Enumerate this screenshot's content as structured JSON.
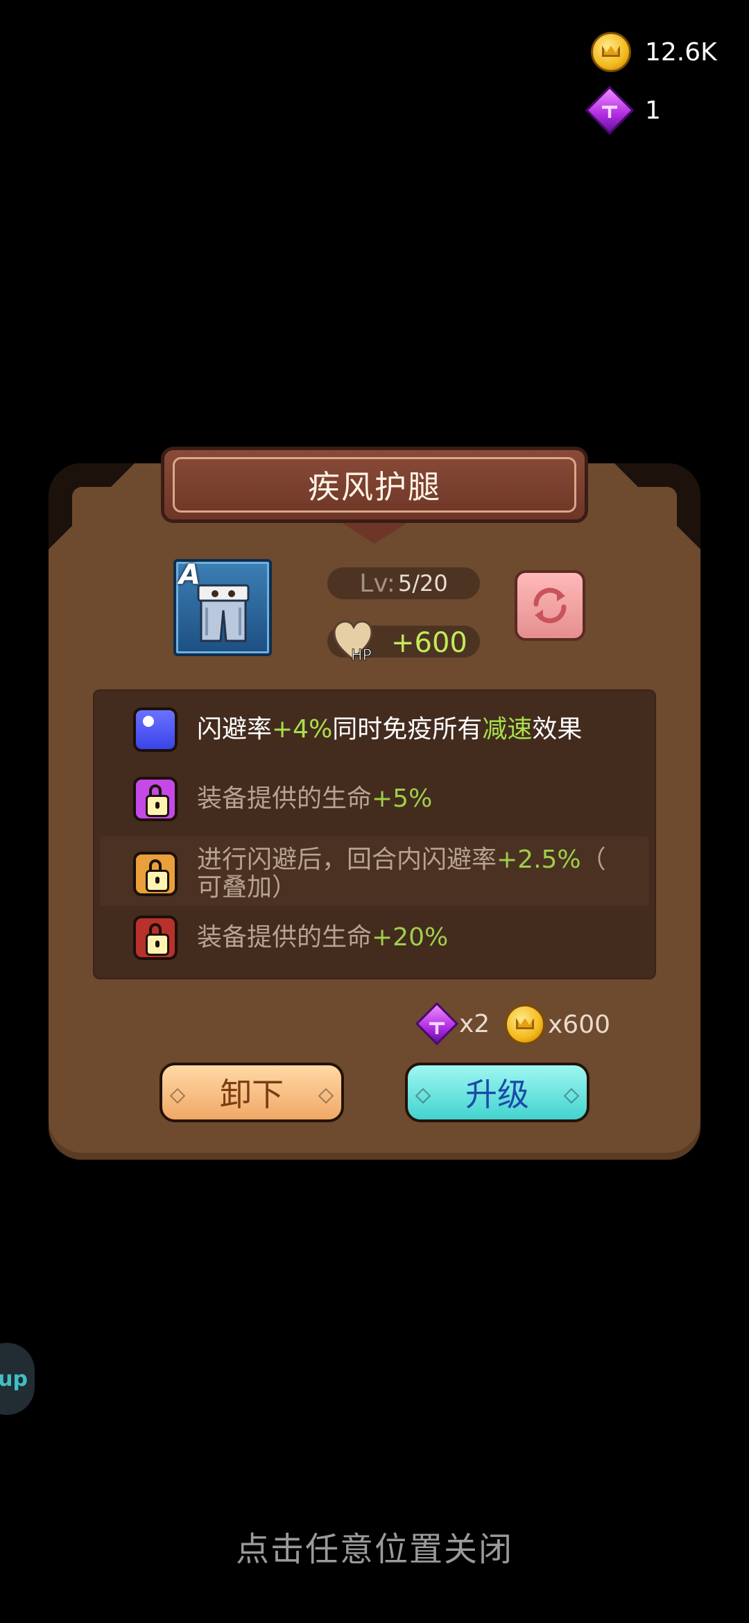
{
  "currency": {
    "coins": "12.6K",
    "gems": "1"
  },
  "item": {
    "name": "疾风护腿",
    "grade": "A",
    "level_label": "Lv:",
    "level_value": "5/20",
    "stat_label": "HP",
    "stat_value": "+600"
  },
  "effects": [
    {
      "state": "active",
      "icon": "blue-dot-icon",
      "parts": [
        "闪避率",
        "+4%",
        "同时免疫所有",
        "减速",
        "效果"
      ]
    },
    {
      "state": "locked",
      "icon": "purple-lock-icon",
      "parts": [
        "装备提供的生命",
        "+5%"
      ]
    },
    {
      "state": "locked",
      "icon": "orange-lock-icon",
      "parts": [
        "进行闪避后，回合内闪避率",
        "+2.5%",
        "（",
        "可叠加）"
      ]
    },
    {
      "state": "locked",
      "icon": "red-lock-icon",
      "parts": [
        "装备提供的生命",
        "+20%"
      ]
    }
  ],
  "cost": {
    "gems": "x2",
    "coins": "x600"
  },
  "buttons": {
    "unequip": "卸下",
    "upgrade": "升级"
  },
  "side_bubble": "up",
  "close_hint": "点击任意位置关闭",
  "colors": {
    "panel": "#6e4a2f",
    "highlight_green": "#a8e04a",
    "upgrade_button": "#43d3cf",
    "unequip_button": "#f0a867"
  }
}
